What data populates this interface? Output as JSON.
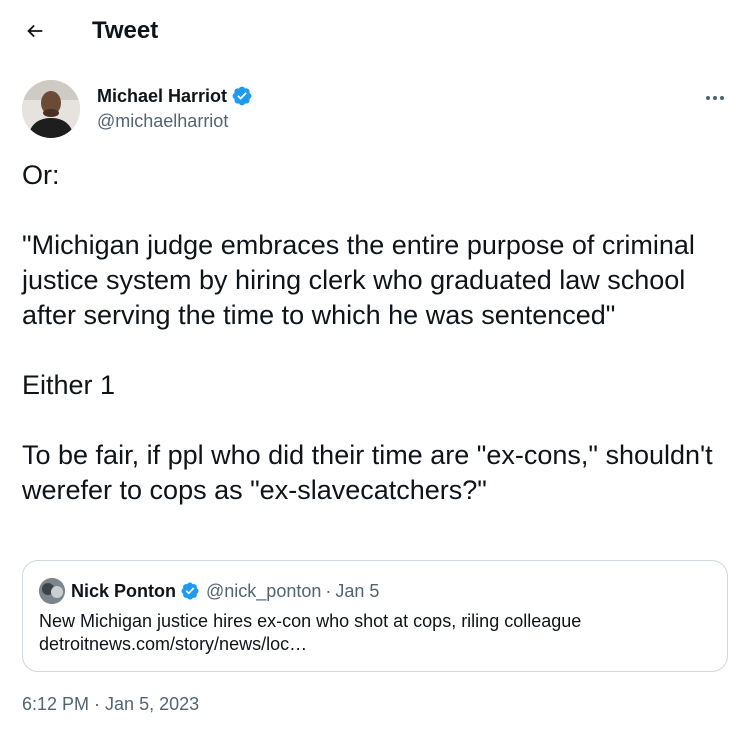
{
  "header": {
    "back_icon": "arrow-left-icon",
    "title": "Tweet"
  },
  "author": {
    "name": "Michael Harriot",
    "handle": "@michaelharriot",
    "verified_color": "#1d9bf0"
  },
  "tweet": {
    "lines": [
      "Or:",
      "\"Michigan judge embraces the entire purpose of criminal justice system by hiring clerk who graduated law school after serving the time to which he was sentenced\"",
      "Either 1",
      "To be fair, if ppl who did their time are \"ex-cons,\" shouldn't werefer to cops as \"ex-slavecatchers?\""
    ],
    "time": "6:12 PM",
    "separator": "·",
    "date": "Jan 5, 2023"
  },
  "quote": {
    "name": "Nick Ponton",
    "handle": "@nick_ponton",
    "separator": "·",
    "date": "Jan 5",
    "text": "New Michigan justice hires ex-con who shot at cops, riling colleague detroitnews.com/story/news/loc…"
  },
  "colors": {
    "text": "#0f1419",
    "secondary": "#536471",
    "border": "#cfd9de",
    "accent": "#1d9bf0"
  }
}
